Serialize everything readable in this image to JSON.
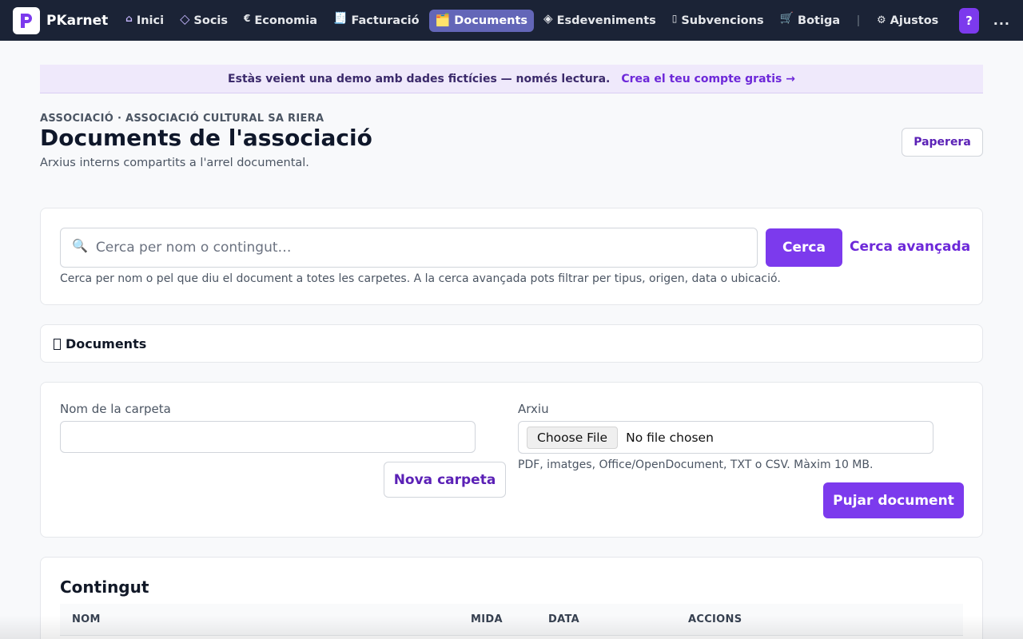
{
  "app": {
    "brand": "PKarnet"
  },
  "nav": {
    "items": [
      {
        "icon": "⌂",
        "label": "Inici"
      },
      {
        "icon": "◇",
        "label": "Socis"
      },
      {
        "icon": "€",
        "label": "Economia"
      },
      {
        "icon": "🧾",
        "label": "Facturació"
      },
      {
        "icon": "🗂️",
        "label": "Documents"
      },
      {
        "icon": "◈",
        "label": "Esdeveniments"
      },
      {
        "icon": "▯",
        "label": "Subvencions"
      },
      {
        "icon": "🛒",
        "label": "Botiga"
      }
    ],
    "active": "Documents",
    "settings_icon": "⚙",
    "settings_label": "Ajustos",
    "help_label": "?",
    "more_label": "..."
  },
  "banner": {
    "text": "Estàs veient una demo amb dades fictícies — només lectura.",
    "link": "Crea el teu compte gratis →"
  },
  "header": {
    "eyebrow": "ASSOCIACIÓ · ASSOCIACIÓ CULTURAL SA RIERA",
    "title": "Documents de l'associació",
    "subtitle": "Arxius interns compartits a l'arrel documental.",
    "trash_label": "Paperera"
  },
  "search": {
    "icon": "🔍",
    "placeholder": "Cerca per nom o contingut…",
    "button": "Cerca",
    "advanced": "Cerca avançada",
    "help": "Cerca per nom o pel que diu el document a totes les carpetes. A la cerca avançada pots filtrar per tipus, origen, data o ubicació."
  },
  "breadcrumb": {
    "label": "Documents"
  },
  "upload": {
    "folder_label": "Nom de la carpeta",
    "folder_value": "",
    "new_folder_button": "Nova carpeta",
    "file_label": "Arxiu",
    "choose_file": "Choose File",
    "no_file": "No file chosen",
    "file_help": "PDF, imatges, Office/OpenDocument, TXT o CSV. Màxim 10 MB.",
    "upload_button": "Pujar document"
  },
  "content": {
    "title": "Contingut",
    "columns": [
      "NOM",
      "MIDA",
      "DATA",
      "ACCIONS"
    ]
  },
  "colors": {
    "nav_bg": "#1b2336",
    "accent": "#7c3aed",
    "active_nav": "#6366b8",
    "banner_bg": "#efe9fb"
  }
}
